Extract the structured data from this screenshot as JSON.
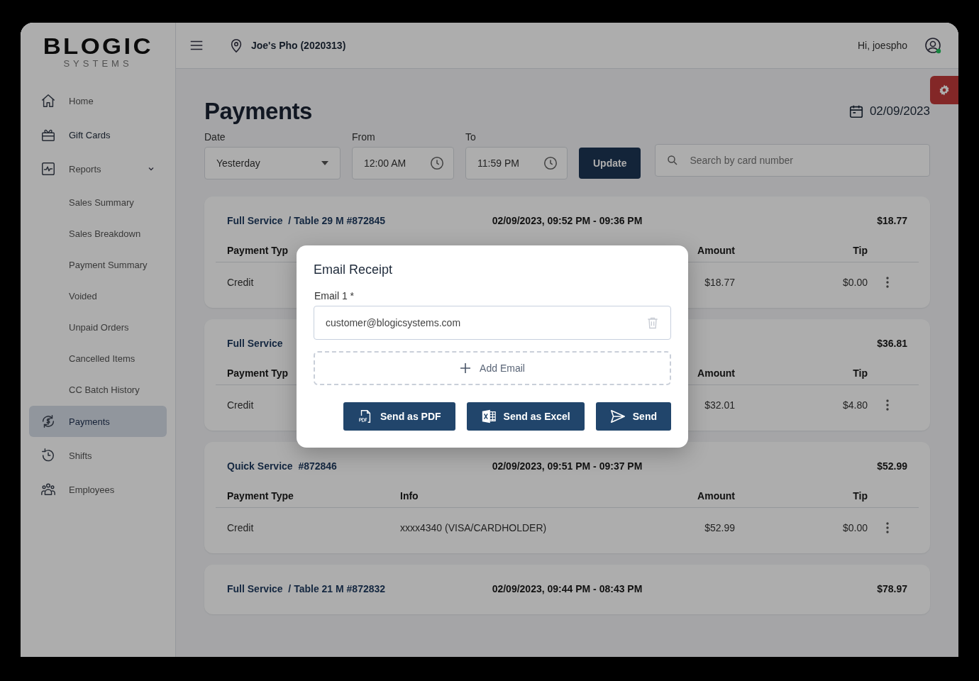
{
  "sidebar": {
    "logo": {
      "brand": "BLOGIC",
      "tagline": "SYSTEMS"
    },
    "items": [
      {
        "label": "Home",
        "selected": false
      },
      {
        "label": "Gift Cards",
        "selected": false
      },
      {
        "label": "Reports",
        "selected": false,
        "expanded": true,
        "children": [
          {
            "label": "Sales Summary",
            "selected": false
          },
          {
            "label": "Sales Breakdown",
            "selected": false
          },
          {
            "label": "Payment Summary",
            "selected": false
          },
          {
            "label": "Voided",
            "selected": false
          },
          {
            "label": "Unpaid Orders",
            "selected": false
          },
          {
            "label": "Cancelled Items",
            "selected": false
          },
          {
            "label": "CC Batch History",
            "selected": false
          }
        ]
      },
      {
        "label": "Payments",
        "selected": true
      },
      {
        "label": "Shifts",
        "selected": false
      },
      {
        "label": "Employees",
        "selected": false
      }
    ]
  },
  "header": {
    "location": "Joe's Pho (2020313)",
    "greeting": "Hi, joespho",
    "online": true
  },
  "page": {
    "title": "Payments",
    "date": "02/09/2023"
  },
  "filters": {
    "date": {
      "label": "Date",
      "value": "Yesterday"
    },
    "from": {
      "label": "From",
      "value": "12:00 AM"
    },
    "to": {
      "label": "To",
      "value": "11:59 PM"
    },
    "update_button": "Update",
    "search": {
      "placeholder": "Search by card number"
    }
  },
  "cards": [
    {
      "title": "Full Service  / Table 29 M #872845",
      "time": "02/09/2023, 09:52 PM - 09:36 PM",
      "total": "$18.77",
      "columns": [
        {
          "label": "Payment Typ",
          "kind": "type"
        },
        {
          "label": "Amount",
          "kind": "amount"
        },
        {
          "label": "Tip",
          "kind": "tip"
        }
      ],
      "rows": [
        {
          "cells": [
            "Credit",
            "$18.77",
            "$0.00"
          ]
        }
      ]
    },
    {
      "title": "Full Service",
      "total": "$36.81",
      "columns": [
        {
          "label": "Payment Typ",
          "kind": "type"
        },
        {
          "label": "Amount",
          "kind": "amount"
        },
        {
          "label": "Tip",
          "kind": "tip"
        }
      ],
      "rows": [
        {
          "cells": [
            "Credit",
            "$32.01",
            "$4.80"
          ]
        }
      ]
    },
    {
      "title": "Quick Service  #872846",
      "time": "02/09/2023, 09:51 PM - 09:37 PM",
      "total": "$52.99",
      "columns": [
        {
          "label": "Payment Type",
          "kind": "type"
        },
        {
          "label": "Info",
          "kind": "info"
        },
        {
          "label": "Amount",
          "kind": "amount"
        },
        {
          "label": "Tip",
          "kind": "tip"
        }
      ],
      "rows": [
        {
          "cells": [
            "Credit",
            "xxxx4340 (VISA/CARDHOLDER)",
            "$52.99",
            "$0.00"
          ]
        }
      ]
    },
    {
      "title": "Full Service  / Table 21 M #872832",
      "time": "02/09/2023, 09:44 PM - 08:43 PM",
      "total": "$78.97"
    }
  ],
  "modal": {
    "title": "Email Receipt",
    "emails": [
      {
        "label": "Email 1 *",
        "value": "customer@blogicsystems.com"
      }
    ],
    "add_button": "Add Email",
    "buttons": [
      {
        "label": "Send as PDF",
        "kind": "pdf"
      },
      {
        "label": "Send as Excel",
        "kind": "excel"
      },
      {
        "label": "Send",
        "kind": "send"
      }
    ]
  }
}
